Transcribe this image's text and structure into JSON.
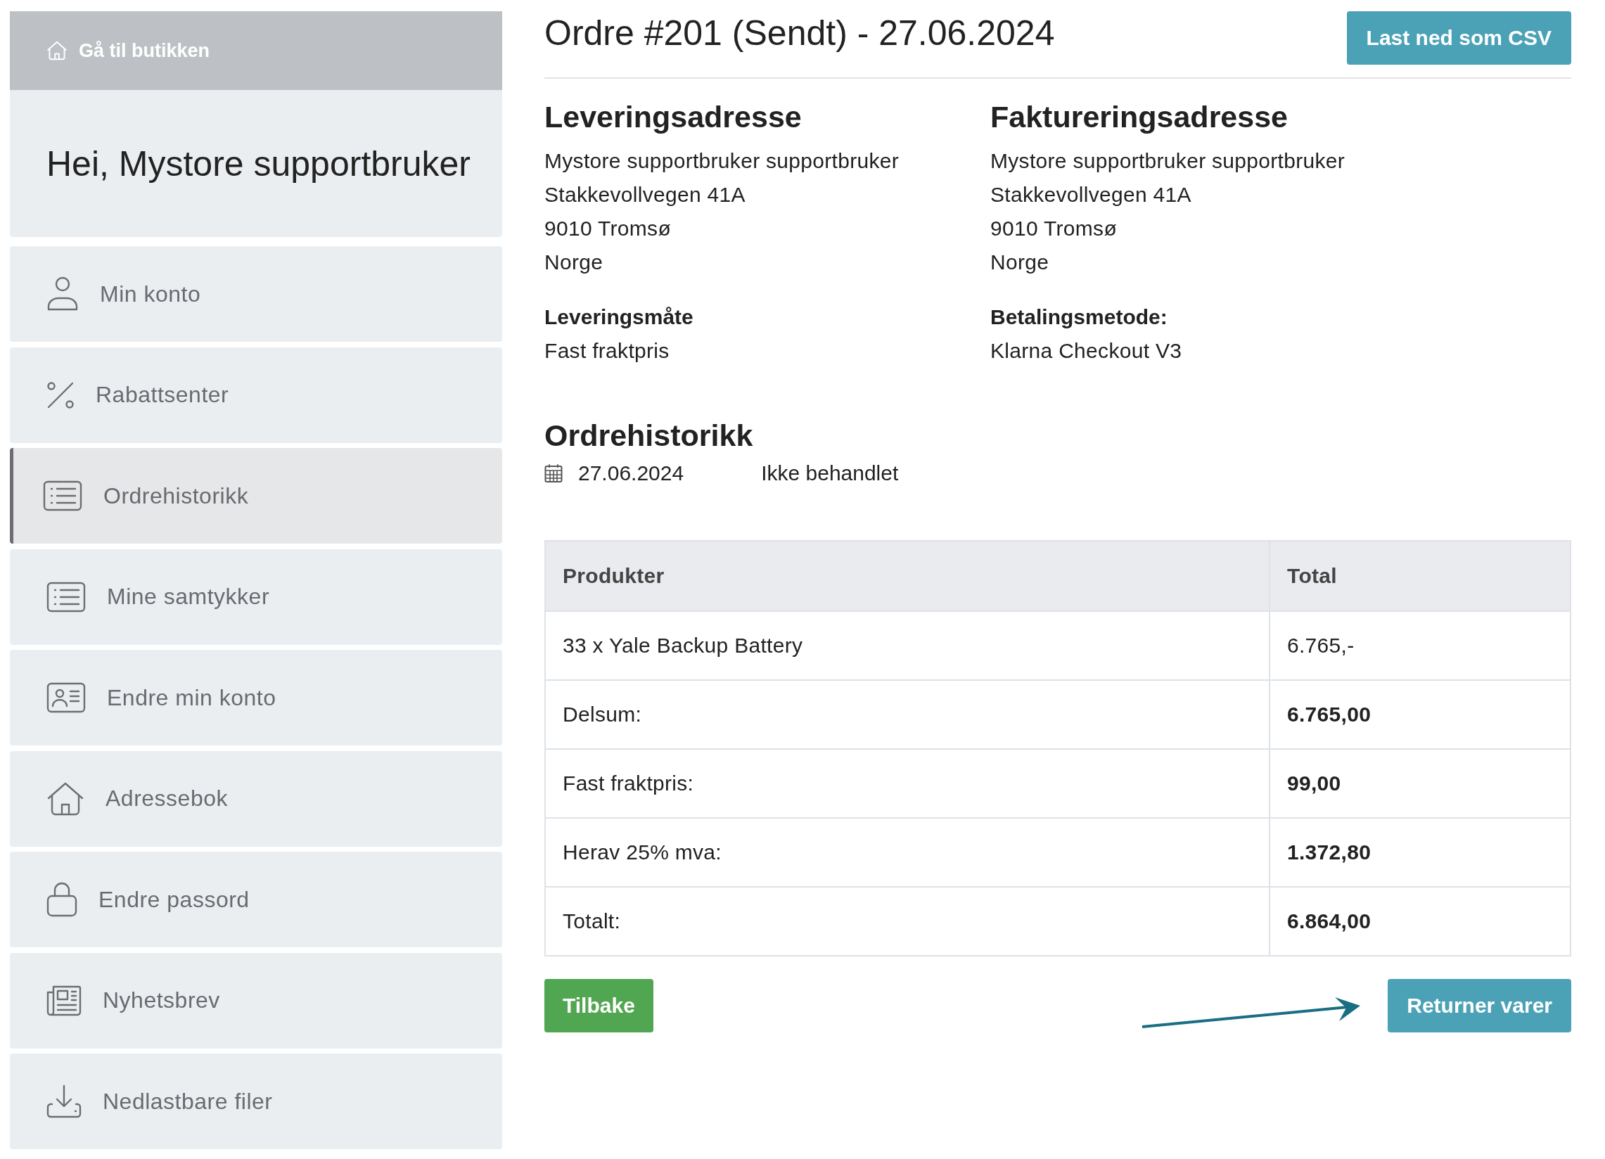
{
  "sidebar": {
    "store_link": "Gå til butikken",
    "greeting": "Hei, Mystore supportbruker",
    "items": [
      {
        "label": "Min konto",
        "selected": false
      },
      {
        "label": "Rabattsenter",
        "selected": false
      },
      {
        "label": "Ordrehistorikk",
        "selected": true
      },
      {
        "label": "Mine samtykker",
        "selected": false
      },
      {
        "label": "Endre min konto",
        "selected": false
      },
      {
        "label": "Adressebok",
        "selected": false
      },
      {
        "label": "Endre passord",
        "selected": false
      },
      {
        "label": "Nyhetsbrev",
        "selected": false
      },
      {
        "label": "Nedlastbare filer",
        "selected": false
      }
    ]
  },
  "order": {
    "title": "Ordre #201 (Sendt) - 27.06.2024",
    "csv_button": "Last ned som CSV",
    "addresses": [
      {
        "heading": "Leveringsadresse",
        "lines": [
          "Mystore supportbruker supportbruker",
          "Stakkevollvegen 41A",
          "9010 Tromsø",
          "Norge"
        ],
        "method_label": "Leveringsmåte",
        "method": "Fast fraktpris"
      },
      {
        "heading": "Faktureringsadresse",
        "lines": [
          "Mystore supportbruker supportbruker",
          "Stakkevollvegen 41A",
          "9010 Tromsø",
          "Norge"
        ],
        "method_label": "Betalingsmetode:",
        "method": "Klarna Checkout V3"
      }
    ],
    "history": {
      "heading": "Ordrehistorikk",
      "entries": [
        {
          "date": "27.06.2024",
          "status": "Ikke behandlet"
        }
      ]
    },
    "table": {
      "columns": [
        "Produkter",
        "Total"
      ],
      "rows": [
        {
          "kind": "item",
          "cells": [
            "33 x Yale Backup Battery",
            "6.765,-"
          ]
        },
        {
          "kind": "summary",
          "cells": [
            "Delsum:",
            "6.765,00"
          ]
        },
        {
          "kind": "summary",
          "cells": [
            "Fast fraktpris:",
            "99,00"
          ]
        },
        {
          "kind": "summary",
          "cells": [
            "Herav 25% mva:",
            "1.372,80"
          ]
        },
        {
          "kind": "summary",
          "cells": [
            "Totalt:",
            "6.864,00"
          ]
        }
      ]
    },
    "back_button": "Tilbake",
    "return_button": "Returner varer"
  }
}
